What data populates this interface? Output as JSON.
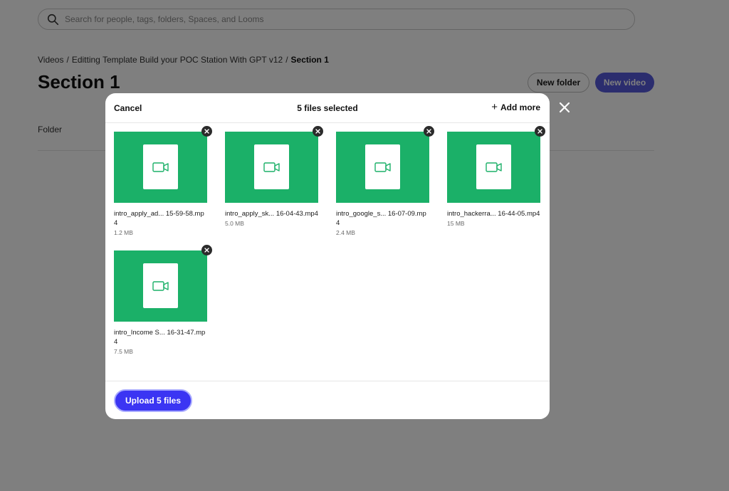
{
  "search": {
    "placeholder": "Search for people, tags, folders, Spaces, and Looms"
  },
  "breadcrumb": {
    "items": [
      "Videos",
      "Editting Template Build your POC Station With GPT v12"
    ],
    "current": "Section 1",
    "separator": "/"
  },
  "page": {
    "title": "Section 1",
    "new_folder_label": "New folder",
    "new_video_label": "New video",
    "folder_label": "Folder"
  },
  "modal": {
    "cancel_label": "Cancel",
    "title": "5 files selected",
    "add_more_label": "Add more",
    "upload_label": "Upload 5 files",
    "files": [
      {
        "name": "intro_apply_ad... 15-59-58.mp4",
        "size": "1.2 MB"
      },
      {
        "name": "intro_apply_sk... 16-04-43.mp4",
        "size": "5.0 MB"
      },
      {
        "name": "intro_google_s... 16-07-09.mp4",
        "size": "2.4 MB"
      },
      {
        "name": "intro_hackerra... 16-44-05.mp4",
        "size": "15 MB"
      },
      {
        "name": "intro_Income S... 16-31-47.mp4",
        "size": "7.5 MB"
      }
    ]
  },
  "colors": {
    "thumbnail": "#1bb068",
    "primary": "#3b35f3",
    "new_video": "#565add"
  },
  "icons": [
    "search-icon",
    "close-icon",
    "plus-icon",
    "video-camera-icon",
    "remove-file-icon"
  ]
}
